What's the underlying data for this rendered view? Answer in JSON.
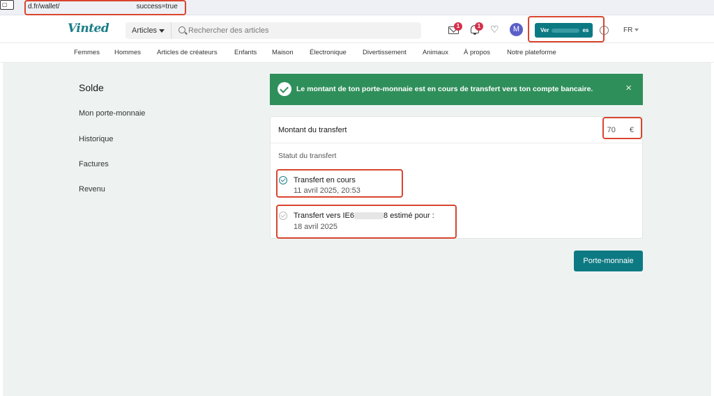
{
  "address": {
    "prefix": "d.fr/wallet/",
    "suffix": "success=true"
  },
  "header": {
    "logo": "Vinted",
    "search": {
      "category": "Articles",
      "placeholder": "Rechercher des articles"
    },
    "inbox_badge": "1",
    "notifications_badge": "1",
    "avatar_letter": "M",
    "sell_button_start": "Ver",
    "sell_button_end": "es",
    "language": "FR"
  },
  "nav": {
    "items": [
      "Femmes",
      "Hommes",
      "Articles de créateurs",
      "Enfants",
      "Maison",
      "Électronique",
      "Divertissement",
      "Animaux",
      "À propos",
      "Notre plateforme"
    ]
  },
  "sidebar": {
    "title": "Solde",
    "items": [
      "Mon porte-monnaie",
      "Historique",
      "Factures",
      "Revenu"
    ]
  },
  "banner": {
    "message": "Le montant de ton porte-monnaie est en cours de transfert vers ton compte bancaire.",
    "close": "×"
  },
  "transfer": {
    "amount_label": "Montant du transfert",
    "amount_prefix": "70",
    "currency": "€",
    "status_label": "Statut du transfert",
    "steps": [
      {
        "title": "Transfert en cours",
        "date": "11 avril 2025, 20:53"
      },
      {
        "title_start": "Transfert vers IE6",
        "title_end": "8 estimé pour :",
        "date": "18 avril 2025"
      }
    ]
  },
  "wallet_button": "Porte-monnaie",
  "colors": {
    "brand": "#0d7a83",
    "success": "#2f8f5a",
    "highlight": "#d9452e",
    "background": "#eef3f2"
  }
}
